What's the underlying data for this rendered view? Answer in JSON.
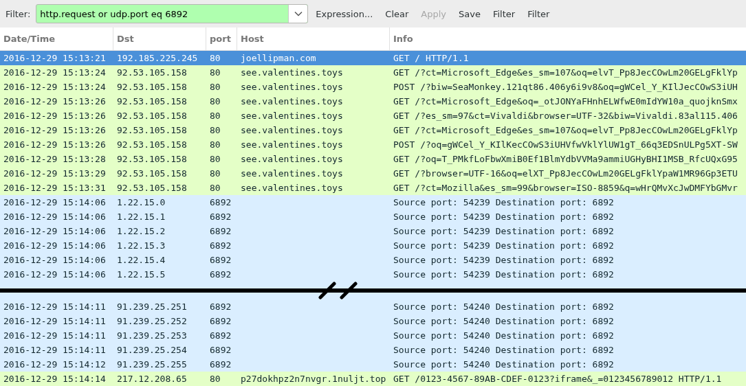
{
  "toolbar": {
    "filter_label": "Filter:",
    "filter_value": "http.request or udp.port eq 6892",
    "filter_valid": true,
    "buttons": [
      {
        "label": "Expression...",
        "disabled": false
      },
      {
        "label": "Clear",
        "disabled": false
      },
      {
        "label": "Apply",
        "disabled": true
      },
      {
        "label": "Save",
        "disabled": false
      },
      {
        "label": "Filter",
        "disabled": false
      },
      {
        "label": "Filter",
        "disabled": false
      }
    ]
  },
  "table": {
    "columns": [
      "Date/Time",
      "Dst",
      "port",
      "Host",
      "Info"
    ],
    "rows": [
      {
        "kind": "http",
        "selected": true,
        "cells": [
          "2016-12-29 15:13:21",
          "192.185.225.245",
          "80",
          "joellipman.com",
          "GET / HTTP/1.1"
        ]
      },
      {
        "kind": "http",
        "selected": false,
        "cells": [
          "2016-12-29 15:13:24",
          "92.53.105.158",
          "80",
          "see.valentines.toys",
          "GET /?ct=Microsoft_Edge&es_sm=107&oq=elvT_Pp8JecCOwLm20GELgFklYp"
        ]
      },
      {
        "kind": "http",
        "selected": false,
        "cells": [
          "2016-12-29 15:13:24",
          "92.53.105.158",
          "80",
          "see.valentines.toys",
          "POST /?biw=SeaMonkey.121qt86.406y6i9v8&oq=gWCel_Y_KIlJecCOwS3iUH"
        ]
      },
      {
        "kind": "http",
        "selected": false,
        "cells": [
          "2016-12-29 15:13:26",
          "92.53.105.158",
          "80",
          "see.valentines.toys",
          "GET /?ct=Microsoft_Edge&oq=_otJONYaFHnhELWfwE0mIdYW10a_quojknSmx"
        ]
      },
      {
        "kind": "http",
        "selected": false,
        "cells": [
          "2016-12-29 15:13:26",
          "92.53.105.158",
          "80",
          "see.valentines.toys",
          "GET /?es_sm=97&ct=Vivaldi&browser=UTF-32&biw=Vivaldi.83al115.406"
        ]
      },
      {
        "kind": "http",
        "selected": false,
        "cells": [
          "2016-12-29 15:13:26",
          "92.53.105.158",
          "80",
          "see.valentines.toys",
          "GET /?ct=Microsoft_Edge&es_sm=107&oq=elvT_Pp8JecCOwLm20GELgFklYp"
        ]
      },
      {
        "kind": "http",
        "selected": false,
        "cells": [
          "2016-12-29 15:13:26",
          "92.53.105.158",
          "80",
          "see.valentines.toys",
          "POST /?oq=gWCel_Y_KIlKecCOwS3iUHVfwVklYlUW1gT_66q3EDSnULPg5XT-SW"
        ]
      },
      {
        "kind": "http",
        "selected": false,
        "cells": [
          "2016-12-29 15:13:28",
          "92.53.105.158",
          "80",
          "see.valentines.toys",
          "GET /?oq=T_PMkfLoFbwXmiB0Ef1BlmYdbVVMa9ammiUGHyBHI1MSB_RfcUQxG95"
        ]
      },
      {
        "kind": "http",
        "selected": false,
        "cells": [
          "2016-12-29 15:13:29",
          "92.53.105.158",
          "80",
          "see.valentines.toys",
          "GET /?browser=UTF-16&oq=elXT_Pp8JecCOwLm20GELgFklYpaW1MR96Gp3ETU"
        ]
      },
      {
        "kind": "http",
        "selected": false,
        "cells": [
          "2016-12-29 15:13:31",
          "92.53.105.158",
          "80",
          "see.valentines.toys",
          "GET /?ct=Mozilla&es_sm=99&browser=ISO-8859&q=wHrQMvXcJwDMFYbGMvr"
        ]
      },
      {
        "kind": "udp",
        "selected": false,
        "cells": [
          "2016-12-29 15:14:06",
          "1.22.15.0",
          "6892",
          "",
          "Source port: 54239  Destination port: 6892"
        ]
      },
      {
        "kind": "udp",
        "selected": false,
        "cells": [
          "2016-12-29 15:14:06",
          "1.22.15.1",
          "6892",
          "",
          "Source port: 54239  Destination port: 6892"
        ]
      },
      {
        "kind": "udp",
        "selected": false,
        "cells": [
          "2016-12-29 15:14:06",
          "1.22.15.2",
          "6892",
          "",
          "Source port: 54239  Destination port: 6892"
        ]
      },
      {
        "kind": "udp",
        "selected": false,
        "cells": [
          "2016-12-29 15:14:06",
          "1.22.15.3",
          "6892",
          "",
          "Source port: 54239  Destination port: 6892"
        ]
      },
      {
        "kind": "udp",
        "selected": false,
        "cells": [
          "2016-12-29 15:14:06",
          "1.22.15.4",
          "6892",
          "",
          "Source port: 54239  Destination port: 6892"
        ]
      },
      {
        "kind": "udp",
        "selected": false,
        "cells": [
          "2016-12-29 15:14:06",
          "1.22.15.5",
          "6892",
          "",
          "Source port: 54239  Destination port: 6892"
        ]
      },
      {
        "kind": "break"
      },
      {
        "kind": "udp",
        "selected": false,
        "cells": [
          "2016-12-29 15:14:11",
          "91.239.25.251",
          "6892",
          "",
          "Source port: 54240  Destination port: 6892"
        ]
      },
      {
        "kind": "udp",
        "selected": false,
        "cells": [
          "2016-12-29 15:14:11",
          "91.239.25.252",
          "6892",
          "",
          "Source port: 54240  Destination port: 6892"
        ]
      },
      {
        "kind": "udp",
        "selected": false,
        "cells": [
          "2016-12-29 15:14:11",
          "91.239.25.253",
          "6892",
          "",
          "Source port: 54240  Destination port: 6892"
        ]
      },
      {
        "kind": "udp",
        "selected": false,
        "cells": [
          "2016-12-29 15:14:11",
          "91.239.25.254",
          "6892",
          "",
          "Source port: 54240  Destination port: 6892"
        ]
      },
      {
        "kind": "udp",
        "selected": false,
        "cells": [
          "2016-12-29 15:14:12",
          "91.239.25.255",
          "6892",
          "",
          "Source port: 54240  Destination port: 6892"
        ]
      },
      {
        "kind": "http",
        "selected": false,
        "cells": [
          "2016-12-29 15:14:14",
          "217.12.208.65",
          "80",
          "p27dokhpz2n7nvgr.1nuljt.top",
          "GET /0123-4567-89AB-CDEF-0123?iframe&_=0123456789012 HTTP/1.1"
        ]
      }
    ]
  }
}
